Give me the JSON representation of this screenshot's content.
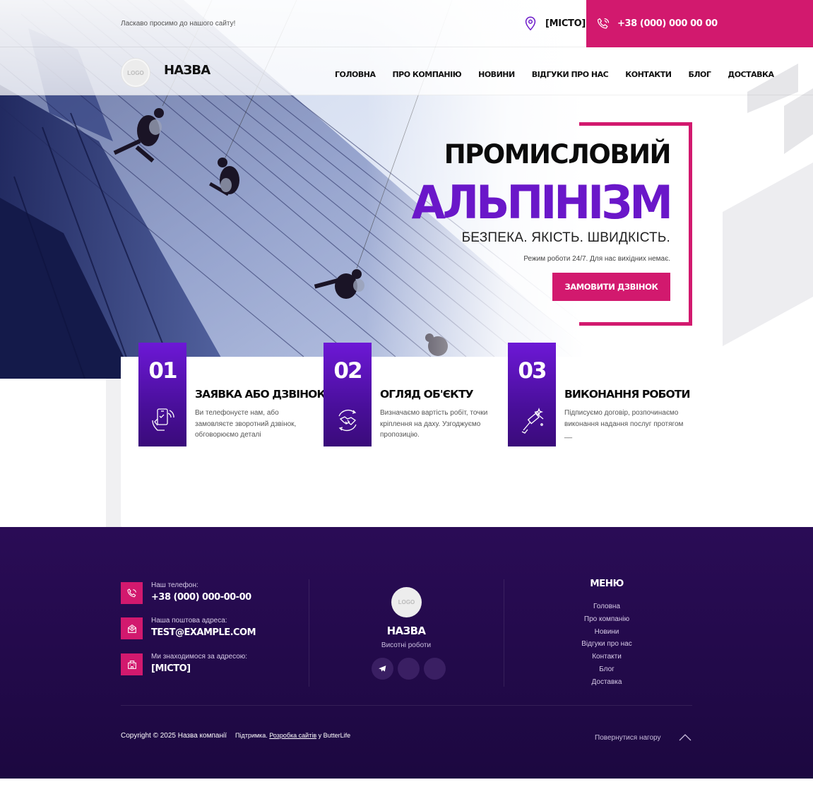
{
  "topbar": {
    "welcome": "Ласкаво просимо до нашого сайту!",
    "city": "[МІСТО]",
    "phone": "+38 (000) 000 00 00"
  },
  "header": {
    "logo_text": "LOGO",
    "brand": "НАЗВА",
    "nav": [
      "ГОЛОВНА",
      "ПРО КОМПАНІЮ",
      "НОВИНИ",
      "ВІДГУКИ ПРО НАС",
      "КОНТАКТИ",
      "БЛОГ",
      "ДОСТАВКА"
    ]
  },
  "hero": {
    "title_line1": "ПРОМИСЛОВИЙ",
    "title_line2": "АЛЬПІНІЗМ",
    "subtitle": "БЕЗПЕКА. ЯКІСТЬ. ШВИДКІСТЬ.",
    "note": "Режим роботи 24/7. Для нас вихідних немає.",
    "cta": "ЗАМОВИТИ ДЗВІНОК"
  },
  "steps": [
    {
      "number": "01",
      "title": "ЗАЯВКА АБО ДЗВІНОК",
      "text": "Ви телефонуєте нам, або замовляєте зворотний дзвінок, обговорюємо деталі",
      "icon": "phone-in-hand-icon"
    },
    {
      "number": "02",
      "title": "ОГЛЯД ОБ'ЄКТУ",
      "text": "Визначаємо вартість робіт, точки кріплення на даху. Узгоджуємо пропозицію.",
      "icon": "handshake-icon"
    },
    {
      "number": "03",
      "title": "ВИКОНАННЯ РОБОТИ",
      "text": "Підписуємо договір, розпочинаємо виконання надання послуг протягом __",
      "icon": "window-squeegee-icon"
    }
  ],
  "footer": {
    "contacts": [
      {
        "label": "Наш телефон:",
        "value": "+38 (000) 000-00-00",
        "icon": "phone-icon"
      },
      {
        "label": "Наша поштова адреса:",
        "value": "TEST@EXAMPLE.COM",
        "icon": "mail-icon"
      },
      {
        "label": "Ми знаходимося за адресою:",
        "value": "[МІСТО]",
        "icon": "building-icon"
      }
    ],
    "logo_text": "LOGO",
    "brand": "НАЗВА",
    "tagline": "Висотні роботи",
    "menu_title": "МЕНЮ",
    "menu": [
      "Головна",
      "Про компанію",
      "Новини",
      "Відгуки про нас",
      "Контакти",
      "Блог",
      "Доставка"
    ],
    "copyright": "Copyright © 2025 Назва компанії",
    "support_prefix": "Підтримка.",
    "support_link": "Розробка сайтів",
    "support_suffix": "у ButterLife",
    "back_to_top": "Повернутися нагору"
  },
  "colors": {
    "accent": "#d2196e",
    "purple": "#6a17c9",
    "footer_bg": "#22094a"
  }
}
